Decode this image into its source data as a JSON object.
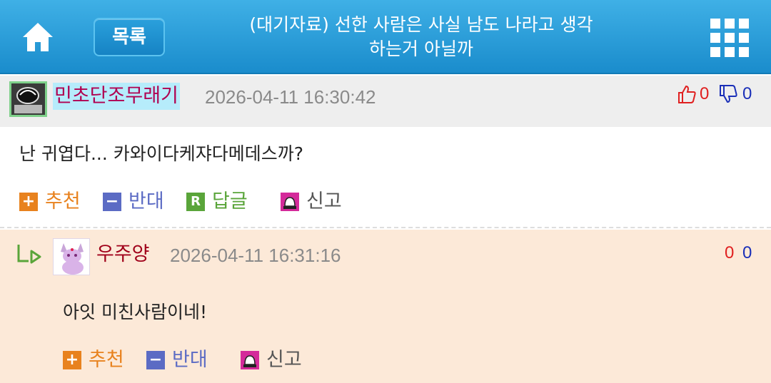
{
  "header": {
    "list_label": "목록",
    "title_line1": "(대기자료) 선한 사람은 사실 남도 나라고 생각",
    "title_line2": "하는거 아닐까",
    "home_icon": "home-icon",
    "menu_icon": "grid-menu-icon"
  },
  "comment1": {
    "author": "민초단조무래기",
    "timestamp": "2026-04-11 16:30:42",
    "likes": "0",
    "dislikes": "0",
    "text": "난 귀엽다... 카와이다케쟈다메데스까?",
    "actions": {
      "recommend": "추천",
      "oppose": "반대",
      "reply": "답글",
      "report": "신고"
    }
  },
  "comment2": {
    "author": "우주양",
    "timestamp": "2026-04-11 16:31:16",
    "likes": "0",
    "dislikes": "0",
    "text": "아잇 미친사람이네!",
    "actions": {
      "recommend": "추천",
      "oppose": "반대",
      "report": "신고"
    }
  },
  "colors": {
    "header": "#1a8ccc",
    "recommend": "#e8821e",
    "oppose": "#5b6bc4",
    "reply": "#5aa53a",
    "report": "#c0218c",
    "like": "#e02020",
    "dislike": "#1a2fb8"
  }
}
